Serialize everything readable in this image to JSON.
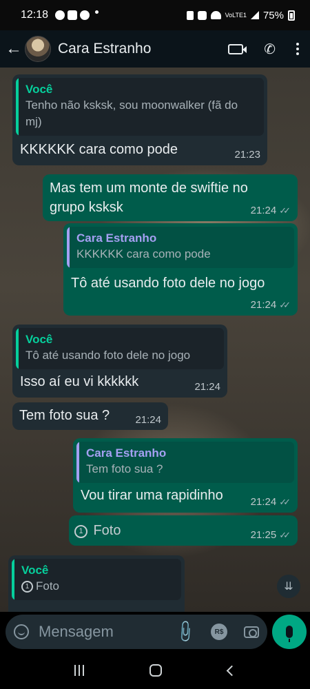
{
  "status_bar": {
    "time": "12:18",
    "network": "VoLTE1",
    "battery": "75%"
  },
  "header": {
    "contact_name": "Cara Estranho"
  },
  "messages": [
    {
      "direction": "incoming",
      "quote_author": "Você",
      "quote_text": "Tenho não ksksk, sou moonwalker (fã do mj)",
      "text": "KKKKKK cara como pode",
      "time": "21:23"
    },
    {
      "direction": "outgoing",
      "text": "Mas tem um monte de swiftie no grupo ksksk",
      "time": "21:24",
      "status": "read"
    },
    {
      "direction": "outgoing",
      "quote_author": "Cara Estranho",
      "quote_text": "KKKKKK cara como pode",
      "text": "Tô até usando foto dele no jogo",
      "time": "21:24",
      "status": "read"
    },
    {
      "direction": "incoming",
      "quote_author": "Você",
      "quote_text": "Tô até usando foto dele no jogo",
      "text": "Isso aí eu vi kkkkkk",
      "time": "21:24"
    },
    {
      "direction": "incoming",
      "text": "Tem foto sua ?",
      "time": "21:24"
    },
    {
      "direction": "outgoing",
      "quote_author": "Cara Estranho",
      "quote_text": "Tem foto sua ?",
      "text": "Vou tirar uma rapidinho",
      "time": "21:24",
      "status": "read"
    },
    {
      "direction": "outgoing",
      "view_once_label": "Foto",
      "view_once_icon": "1",
      "time": "21:25",
      "status": "read"
    },
    {
      "direction": "incoming",
      "quote_author": "Você",
      "quote_text": "Foto",
      "quote_icon": "1"
    }
  ],
  "composer": {
    "placeholder": "Mensagem",
    "payment_label": "R$"
  },
  "colors": {
    "incoming_bubble": "#202c33",
    "outgoing_bubble": "#005c4b",
    "accent_green": "#00a884",
    "quote_you": "#06cf9c",
    "quote_contact": "#a5a0f2"
  }
}
